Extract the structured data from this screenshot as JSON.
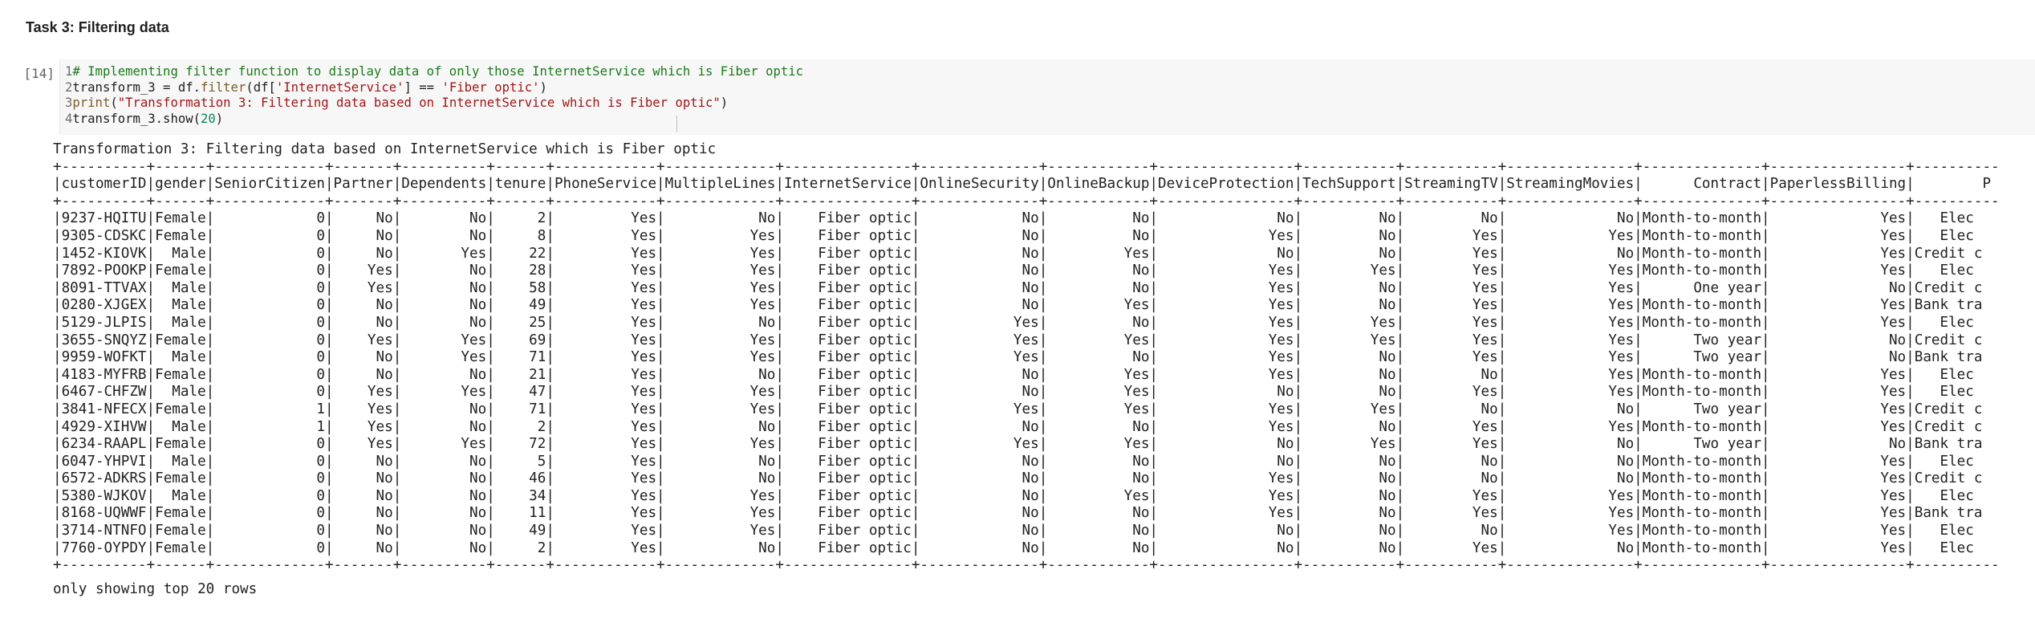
{
  "cell_heading": "Task 3: Filtering data",
  "cell": {
    "execution_count": "[14]",
    "code_lines": [
      {
        "no": "1",
        "parts": [
          {
            "t": "# Implementing filter function to display data of only those InternetService which is Fiber optic",
            "c": "c-comment"
          }
        ]
      },
      {
        "no": "2",
        "parts": [
          {
            "t": "transform_3 = df.",
            "c": ""
          },
          {
            "t": "filter",
            "c": "c-fn"
          },
          {
            "t": "(df[",
            "c": ""
          },
          {
            "t": "'InternetService'",
            "c": "c-str"
          },
          {
            "t": "] == ",
            "c": ""
          },
          {
            "t": "'Fiber optic'",
            "c": "c-str"
          },
          {
            "t": ")",
            "c": ""
          }
        ]
      },
      {
        "no": "3",
        "parts": [
          {
            "t": "print",
            "c": "c-fn"
          },
          {
            "t": "(",
            "c": ""
          },
          {
            "t": "\"Transformation 3: Filtering data based on InternetService which is Fiber optic\"",
            "c": "c-str"
          },
          {
            "t": ")",
            "c": ""
          }
        ]
      },
      {
        "no": "4",
        "parts": [
          {
            "t": "transform_3.show(",
            "c": ""
          },
          {
            "t": "20",
            "c": "c-num"
          },
          {
            "t": ")",
            "c": ""
          }
        ]
      }
    ]
  },
  "output": {
    "message": "Transformation 3: Filtering data based on InternetService which is Fiber optic",
    "border_line": "+----------+------+-------------+-------+----------+------+------------+-------------+---------------+--------------+------------+----------------+-----------+-----------+---------------+--------------+----------------+----------",
    "header_line": "|customerID|gender|SeniorCitizen|Partner|Dependents|tenure|PhoneService|MultipleLines|InternetService|OnlineSecurity|OnlineBackup|DeviceProtection|TechSupport|StreamingTV|StreamingMovies|      Contract|PaperlessBilling|        P",
    "rows": [
      "|9237-HQITU|Female|            0|     No|        No|     2|         Yes|           No|    Fiber optic|            No|          No|              No|         No|         No|             No|Month-to-month|             Yes|   Elec",
      "|9305-CDSKC|Female|            0|     No|        No|     8|         Yes|          Yes|    Fiber optic|            No|          No|             Yes|         No|        Yes|            Yes|Month-to-month|             Yes|   Elec",
      "|1452-KIOVK|  Male|            0|     No|       Yes|    22|         Yes|          Yes|    Fiber optic|            No|         Yes|              No|         No|        Yes|             No|Month-to-month|             Yes|Credit c",
      "|7892-POOKP|Female|            0|    Yes|        No|    28|         Yes|          Yes|    Fiber optic|            No|          No|             Yes|        Yes|        Yes|            Yes|Month-to-month|             Yes|   Elec",
      "|8091-TTVAX|  Male|            0|    Yes|        No|    58|         Yes|          Yes|    Fiber optic|            No|          No|             Yes|         No|        Yes|            Yes|      One year|              No|Credit c",
      "|0280-XJGEX|  Male|            0|     No|        No|    49|         Yes|          Yes|    Fiber optic|            No|         Yes|             Yes|         No|        Yes|            Yes|Month-to-month|             Yes|Bank tra",
      "|5129-JLPIS|  Male|            0|     No|        No|    25|         Yes|           No|    Fiber optic|           Yes|          No|             Yes|        Yes|        Yes|            Yes|Month-to-month|             Yes|   Elec",
      "|3655-SNQYZ|Female|            0|    Yes|       Yes|    69|         Yes|          Yes|    Fiber optic|           Yes|         Yes|             Yes|        Yes|        Yes|            Yes|      Two year|              No|Credit c",
      "|9959-WOFKT|  Male|            0|     No|       Yes|    71|         Yes|          Yes|    Fiber optic|           Yes|          No|             Yes|         No|        Yes|            Yes|      Two year|              No|Bank tra",
      "|4183-MYFRB|Female|            0|     No|        No|    21|         Yes|           No|    Fiber optic|            No|         Yes|             Yes|         No|         No|            Yes|Month-to-month|             Yes|   Elec",
      "|6467-CHFZW|  Male|            0|    Yes|       Yes|    47|         Yes|          Yes|    Fiber optic|            No|         Yes|              No|         No|        Yes|            Yes|Month-to-month|             Yes|   Elec",
      "|3841-NFECX|Female|            1|    Yes|        No|    71|         Yes|          Yes|    Fiber optic|           Yes|         Yes|             Yes|        Yes|         No|             No|      Two year|             Yes|Credit c",
      "|4929-XIHVW|  Male|            1|    Yes|        No|     2|         Yes|           No|    Fiber optic|            No|          No|             Yes|         No|        Yes|            Yes|Month-to-month|             Yes|Credit c",
      "|6234-RAAPL|Female|            0|    Yes|       Yes|    72|         Yes|          Yes|    Fiber optic|           Yes|         Yes|              No|        Yes|        Yes|             No|      Two year|              No|Bank tra",
      "|6047-YHPVI|  Male|            0|     No|        No|     5|         Yes|           No|    Fiber optic|            No|          No|              No|         No|         No|             No|Month-to-month|             Yes|   Elec",
      "|6572-ADKRS|Female|            0|     No|        No|    46|         Yes|           No|    Fiber optic|            No|          No|             Yes|         No|         No|             No|Month-to-month|             Yes|Credit c",
      "|5380-WJKOV|  Male|            0|     No|        No|    34|         Yes|          Yes|    Fiber optic|            No|         Yes|             Yes|         No|        Yes|            Yes|Month-to-month|             Yes|   Elec",
      "|8168-UQWWF|Female|            0|     No|        No|    11|         Yes|          Yes|    Fiber optic|            No|          No|             Yes|         No|        Yes|            Yes|Month-to-month|             Yes|Bank tra",
      "|3714-NTNFO|Female|            0|     No|        No|    49|         Yes|          Yes|    Fiber optic|            No|          No|              No|         No|         No|            Yes|Month-to-month|             Yes|   Elec",
      "|7760-OYPDY|Female|            0|     No|        No|     2|         Yes|           No|    Fiber optic|            No|          No|              No|         No|        Yes|             No|Month-to-month|             Yes|   Elec"
    ],
    "footer": "only showing top 20 rows"
  }
}
